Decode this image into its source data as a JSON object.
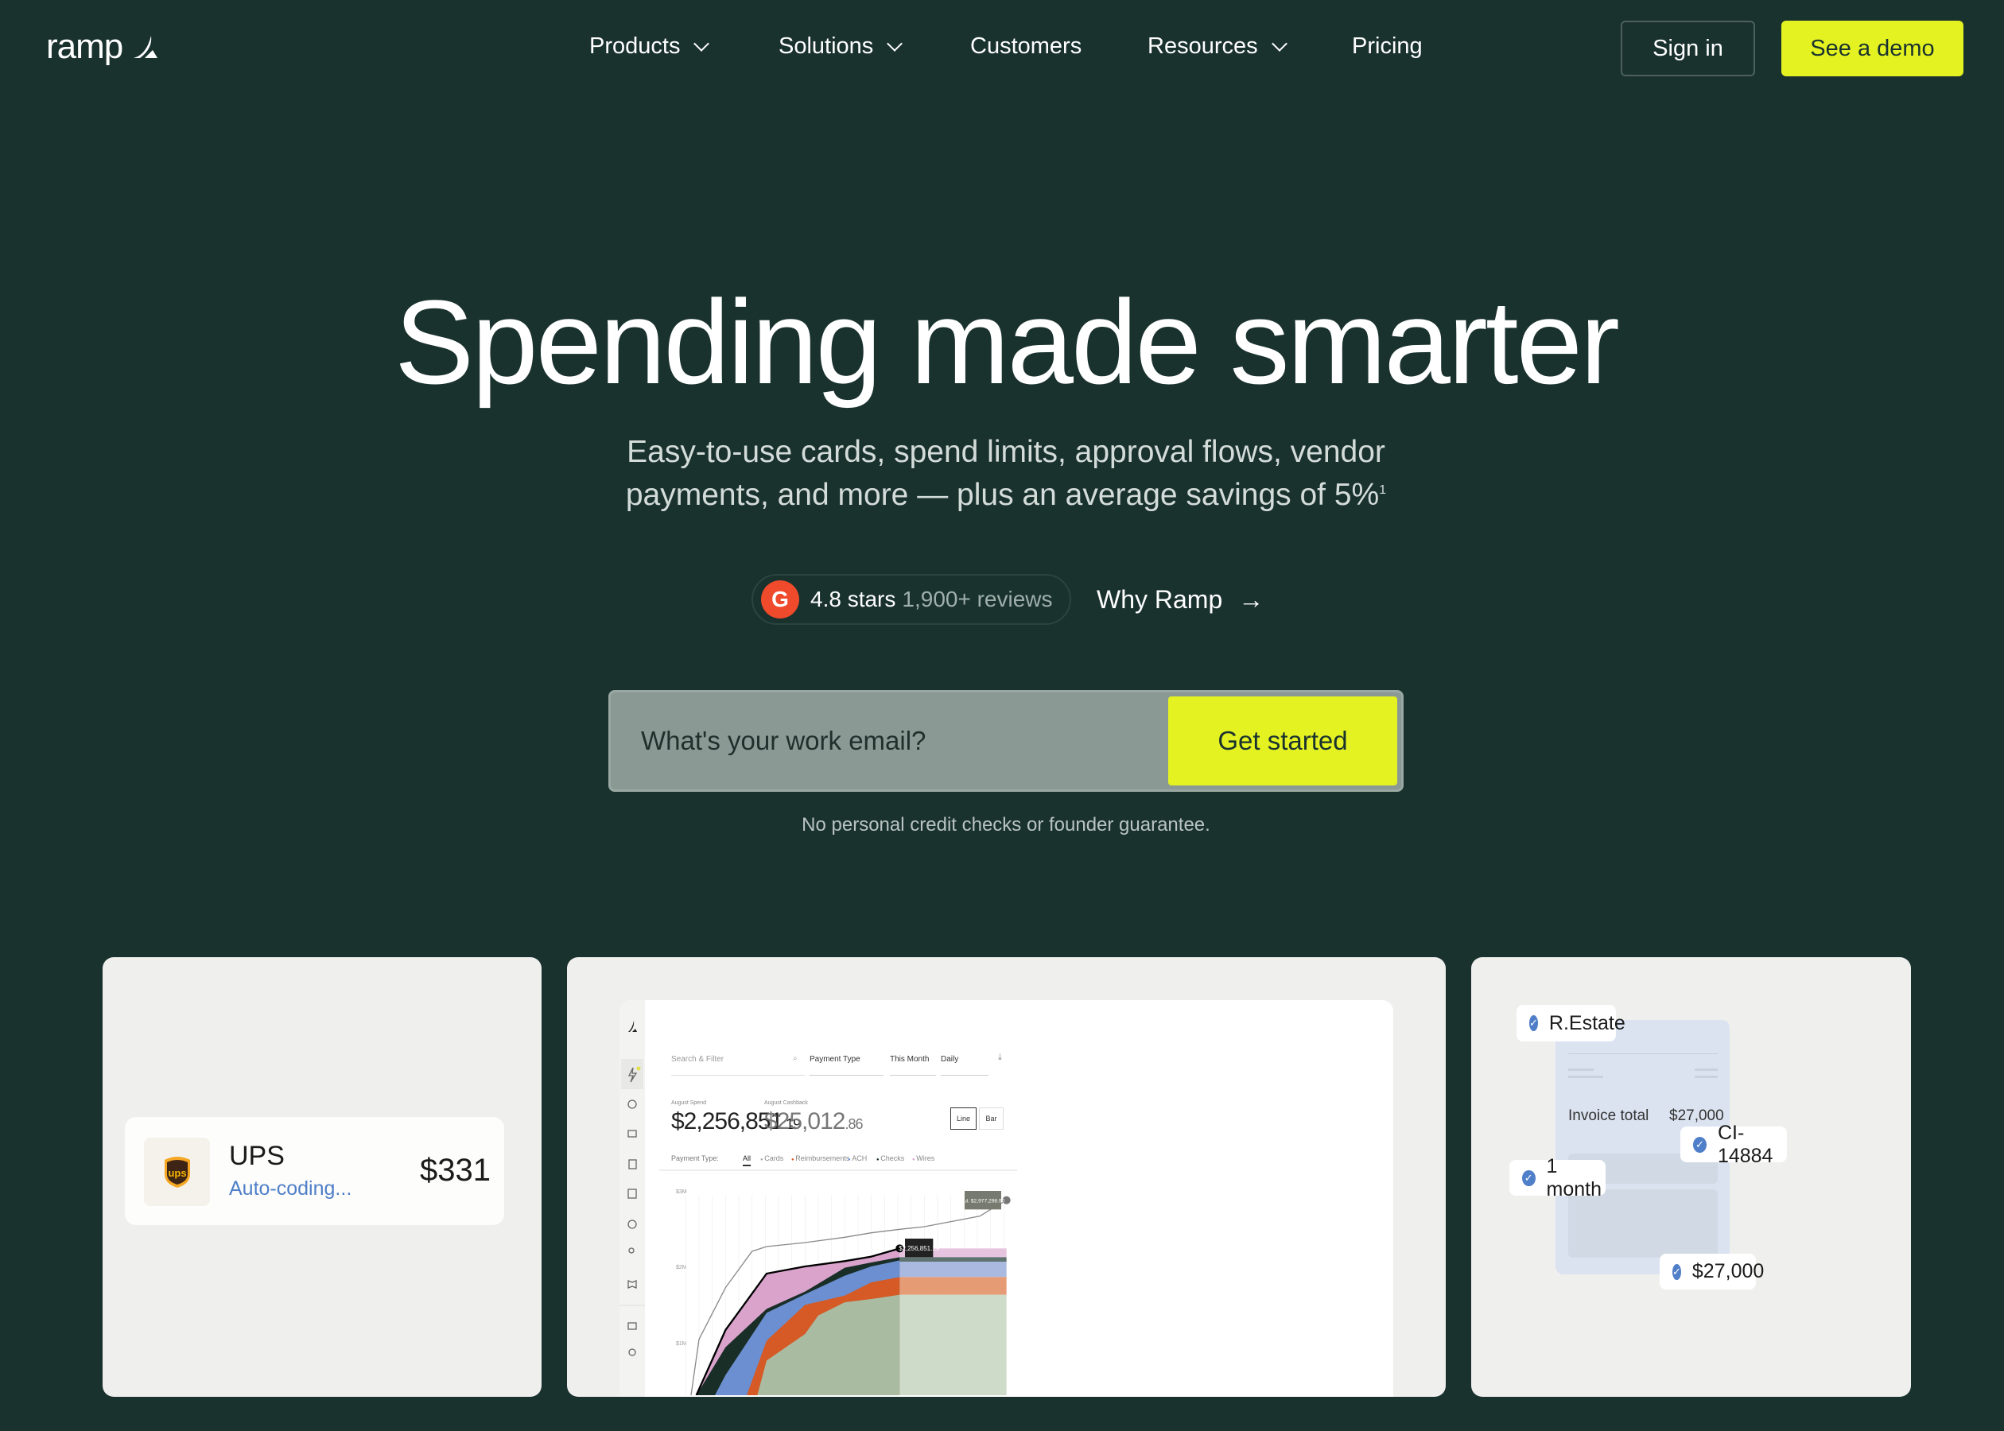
{
  "header": {
    "logo": "ramp",
    "nav": [
      {
        "label": "Products",
        "dropdown": true
      },
      {
        "label": "Solutions",
        "dropdown": true
      },
      {
        "label": "Customers"
      },
      {
        "label": "Resources",
        "dropdown": true
      },
      {
        "label": "Pricing"
      }
    ],
    "sign_in": "Sign in",
    "demo": "See a demo"
  },
  "hero": {
    "title": "Spending made smarter",
    "subtitle_line1": "Easy-to-use cards, spend limits, approval flows, vendor",
    "subtitle_line2": "payments, and more — plus an average savings of 5%",
    "footnote": "1",
    "rating": {
      "badge": "G",
      "stars": "4.8 stars",
      "reviews": "1,900+ reviews"
    },
    "why": "Why Ramp",
    "email_placeholder": "What's your work email?",
    "cta": "Get started",
    "note": "No personal credit checks or founder guarantee."
  },
  "ups_card": {
    "vendor": "UPS",
    "logo_text": "ups",
    "status": "Auto-coding...",
    "amount": "$331"
  },
  "dashboard": {
    "search": "Search & Filter",
    "payment_type": "Payment Type",
    "period": "This Month",
    "interval": "Daily",
    "spend_label": "August Spend",
    "spend": "$2,256,851",
    "spend_cents": ".19",
    "cashback_label": "August Cashback",
    "cashback": "$25,012",
    "cashback_cents": ".86",
    "line": "Line",
    "bar": "Bar",
    "filter_label": "Payment Type:",
    "filters": [
      "All",
      "Cards",
      "Reimbursements",
      "ACH",
      "Checks",
      "Wires"
    ],
    "filter_colors": [
      "#333333",
      "#a9a9a9",
      "#d55a25",
      "#6b8fd0",
      "#1a2e28",
      "#d9a3cc"
    ],
    "y_ticks": [
      "$3M",
      "$2M",
      "$1M"
    ],
    "tooltip_current": "$2,256,851.19",
    "tooltip_projected": "Jul. $2,977,298.90"
  },
  "invoice_card": {
    "invoice_label": "Invoice total",
    "invoice_total": "$27,000",
    "chips": [
      "R.Estate",
      "CI-14884",
      "1 month",
      "$27,000"
    ]
  },
  "colors": {
    "background": "#1a322e",
    "accent": "#e4f222",
    "check": "#4f7fc8"
  }
}
